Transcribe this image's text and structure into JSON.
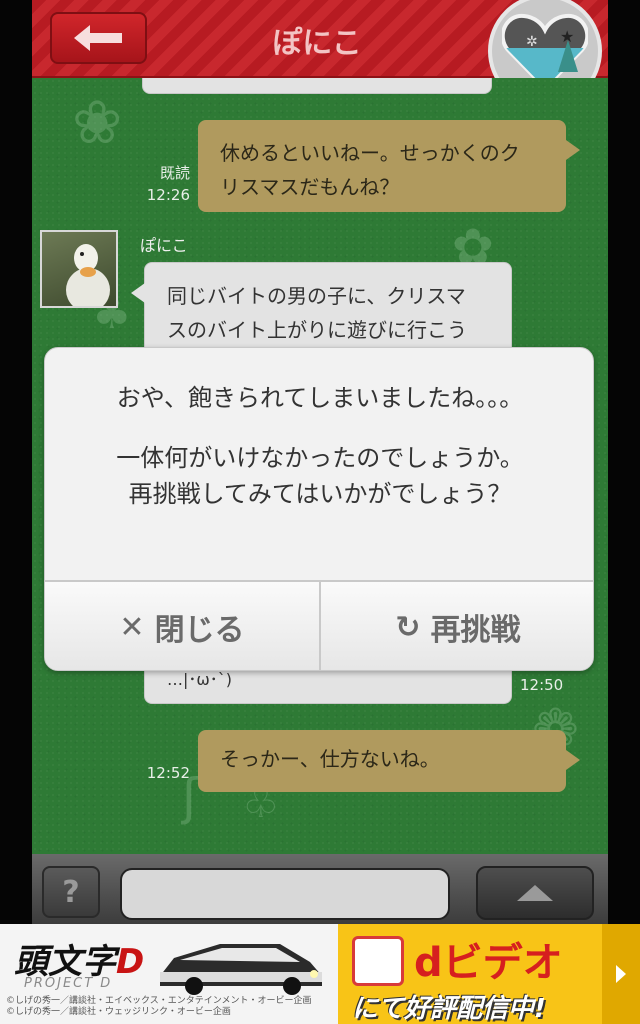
{
  "header": {
    "title": "ぽにこ"
  },
  "messages": {
    "m1": {
      "lines": [
        "休めるといいねー。せっかくのク",
        "リスマスだもんね？"
      ],
      "read_label": "既読",
      "time": "12:26"
    },
    "m2": {
      "sender": "ぽにこ",
      "lines": [
        "同じバイトの男の子に、クリスマ",
        "スのバイト上がりに遊びに行こう"
      ]
    },
    "m3": {
      "partial": "…|･ω･`)",
      "time": "12:50"
    },
    "m4": {
      "text": "そっかー、仕方ないね。",
      "time": "12:52"
    }
  },
  "dialog": {
    "line1": "おや、飽きられてしまいましたね。。。",
    "line2": "一体何がいけなかったのでしょうか。",
    "line3": "再挑戦してみてはいかがでしょう？",
    "close_label": "閉じる",
    "retry_label": "再挑戦"
  },
  "inputbar": {
    "help_label": "?",
    "input_value": ""
  },
  "ad": {
    "left_logo_prefix": "頭文字",
    "left_logo_letter": "D",
    "left_sub": "PROJECT D",
    "left_credit_1": "©しげの秀一／講談社・エイベックス・エンタテインメント・オービー企画",
    "left_credit_2": "©しげの秀一／講談社・ウェッジリンク・オービー企画",
    "right_brand": "dビデオ",
    "right_tagline": "にて好評配信中!"
  },
  "colors": {
    "header_red": "#c8282e",
    "chat_green": "#2e7a35",
    "bubble_gold": "#b09a5e",
    "bubble_grey": "#e3e3e3",
    "ad_yellow": "#f8c417"
  }
}
